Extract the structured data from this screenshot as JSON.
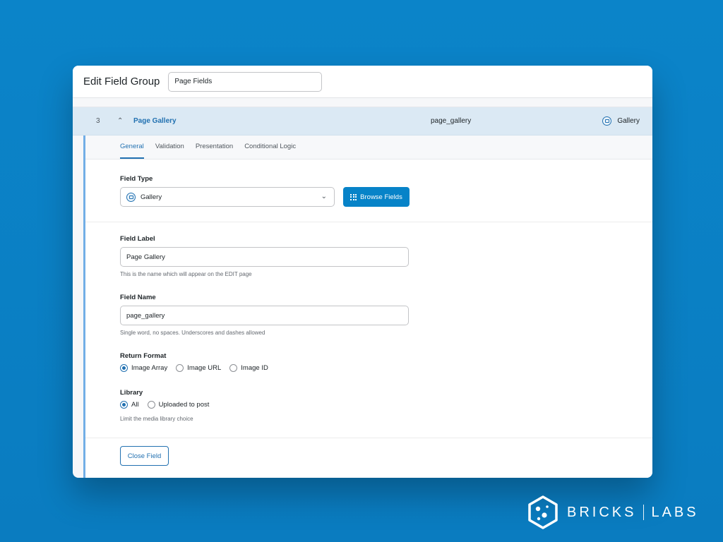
{
  "header": {
    "title": "Edit Field Group",
    "group_name_value": "Page Fields"
  },
  "field_row": {
    "order": "3",
    "label": "Page Gallery",
    "name": "page_gallery",
    "type": "Gallery",
    "type_icon": "gallery-icon",
    "expanded": true
  },
  "tabs": [
    {
      "label": "General",
      "active": true
    },
    {
      "label": "Validation",
      "active": false
    },
    {
      "label": "Presentation",
      "active": false
    },
    {
      "label": "Conditional Logic",
      "active": false
    }
  ],
  "field_type": {
    "label": "Field Type",
    "value": "Gallery",
    "browse_button": "Browse Fields"
  },
  "field_label": {
    "label": "Field Label",
    "value": "Page Gallery",
    "help": "This is the name which will appear on the EDIT page"
  },
  "field_name": {
    "label": "Field Name",
    "value": "page_gallery",
    "help": "Single word, no spaces. Underscores and dashes allowed"
  },
  "return_format": {
    "label": "Return Format",
    "options": [
      {
        "label": "Image Array",
        "selected": true
      },
      {
        "label": "Image URL",
        "selected": false
      },
      {
        "label": "Image ID",
        "selected": false
      }
    ]
  },
  "library": {
    "label": "Library",
    "options": [
      {
        "label": "All",
        "selected": true
      },
      {
        "label": "Uploaded to post",
        "selected": false
      }
    ],
    "help": "Limit the media library choice"
  },
  "close_button": "Close Field",
  "brand": {
    "left": "BRICKS",
    "right": "LABS"
  },
  "colors": {
    "background": "#0a7fc4",
    "accent": "#2271b1",
    "primary_button": "#0783c8",
    "row_highlight": "#dbe9f4"
  }
}
